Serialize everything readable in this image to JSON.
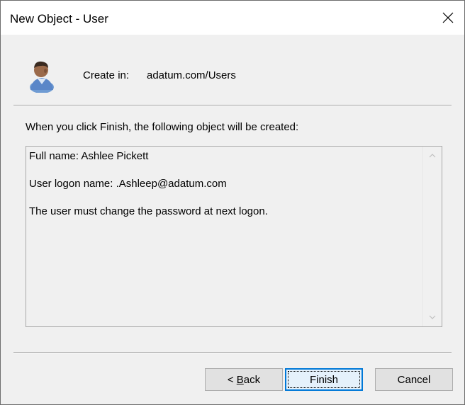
{
  "window": {
    "title": "New Object - User"
  },
  "header": {
    "icon": "user-icon",
    "create_in_label": "Create in:",
    "create_in_path": "adatum.com/Users"
  },
  "instruction": "When you click Finish, the following object will be created:",
  "summary": {
    "lines": [
      "Full name: Ashlee Pickett",
      "User logon name: .Ashleep@adatum.com",
      "The user must change the password at next logon."
    ]
  },
  "buttons": {
    "back_prefix": "< ",
    "back_accel": "B",
    "back_rest": "ack",
    "finish": "Finish",
    "cancel": "Cancel"
  },
  "colors": {
    "focus_border": "#0078d7",
    "dialog_bg": "#f0f0f0"
  }
}
